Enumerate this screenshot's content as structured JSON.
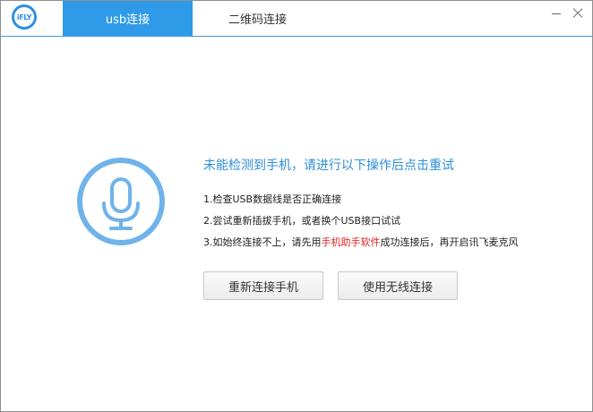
{
  "app": {
    "logo_text": "iFLY",
    "accent_color": "#2f9be8"
  },
  "tabs": [
    {
      "label": "usb连接",
      "active": true
    },
    {
      "label": "二维码连接",
      "active": false
    }
  ],
  "window_controls": {
    "minimize_icon": "minimize-icon",
    "close_icon": "close-icon"
  },
  "message": {
    "title": "未能检测到手机，请进行以下操作后点击重试",
    "steps": [
      "1.检查USB数据线是否正确连接",
      "2.尝试重新插拔手机，或者换个USB接口试试"
    ],
    "step3_prefix": "3.如始终连接不上，请先用",
    "step3_highlight": "手机助手软件",
    "step3_suffix": "成功连接后，再开启讯飞麦克风",
    "highlight_color": "#e01e1e"
  },
  "icon": {
    "name": "microphone-icon",
    "color": "#6fb3ea"
  },
  "buttons": {
    "reconnect": "重新连接手机",
    "wireless": "使用无线连接"
  }
}
